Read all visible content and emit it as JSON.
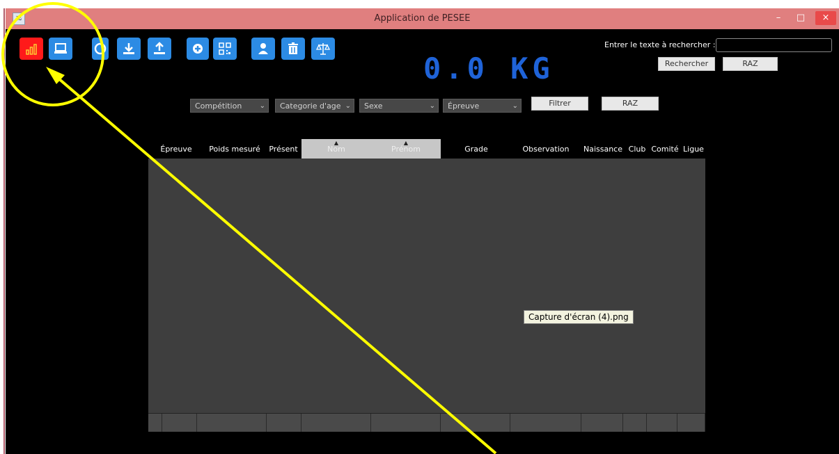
{
  "window": {
    "title": "Application de PESEE",
    "minimize_symbol": "–",
    "maximize_symbol": "□",
    "close_symbol": "×"
  },
  "toolbar": {
    "icons": [
      "bar-chart-icon",
      "laptop-icon",
      "refresh-icon",
      "download-icon",
      "upload-icon",
      "add-circle-icon",
      "qr-code-icon",
      "user-icon",
      "trash-icon",
      "scale-icon"
    ]
  },
  "weight_display": "0.0 KG",
  "search": {
    "label": "Entrer le texte à rechercher :",
    "value": "",
    "search_button": "Rechercher",
    "reset_button": "RAZ"
  },
  "filters": {
    "dropdowns": [
      "Compétition",
      "Categorie d'age",
      "Sexe",
      "Épreuve"
    ],
    "filter_button": "Filtrer",
    "reset_button": "RAZ"
  },
  "table": {
    "columns": [
      "Épreuve",
      "Poids mesuré",
      "Présent",
      "Nom",
      "Prénom",
      "Grade",
      "Observation",
      "Naissance",
      "Club",
      "Comité",
      "Ligue"
    ],
    "rows": []
  },
  "tooltip": "Capture d'écran (4).png",
  "colors": {
    "titlebar": "#e07f7f",
    "accent_blue": "#2c8be4",
    "active_red": "#ff1a1a",
    "weight_blue": "#1f63d8",
    "annotation_yellow": "#ffff00"
  }
}
